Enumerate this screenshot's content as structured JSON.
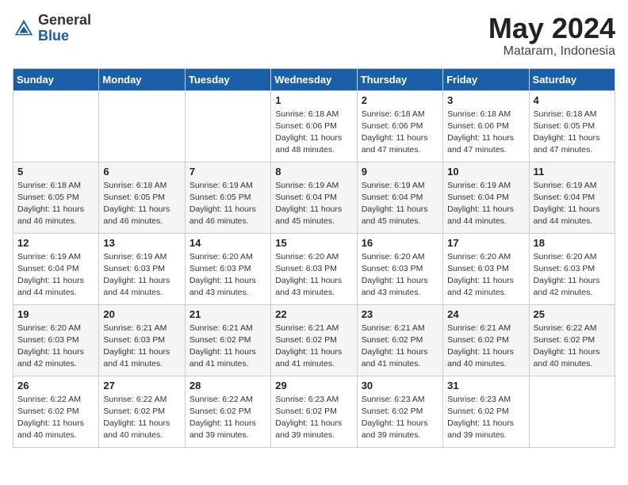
{
  "logo": {
    "general": "General",
    "blue": "Blue"
  },
  "title": {
    "month": "May 2024",
    "location": "Mataram, Indonesia"
  },
  "weekdays": [
    "Sunday",
    "Monday",
    "Tuesday",
    "Wednesday",
    "Thursday",
    "Friday",
    "Saturday"
  ],
  "weeks": [
    [
      {
        "day": "",
        "info": ""
      },
      {
        "day": "",
        "info": ""
      },
      {
        "day": "",
        "info": ""
      },
      {
        "day": "1",
        "info": "Sunrise: 6:18 AM\nSunset: 6:06 PM\nDaylight: 11 hours\nand 48 minutes."
      },
      {
        "day": "2",
        "info": "Sunrise: 6:18 AM\nSunset: 6:06 PM\nDaylight: 11 hours\nand 47 minutes."
      },
      {
        "day": "3",
        "info": "Sunrise: 6:18 AM\nSunset: 6:06 PM\nDaylight: 11 hours\nand 47 minutes."
      },
      {
        "day": "4",
        "info": "Sunrise: 6:18 AM\nSunset: 6:05 PM\nDaylight: 11 hours\nand 47 minutes."
      }
    ],
    [
      {
        "day": "5",
        "info": "Sunrise: 6:18 AM\nSunset: 6:05 PM\nDaylight: 11 hours\nand 46 minutes."
      },
      {
        "day": "6",
        "info": "Sunrise: 6:18 AM\nSunset: 6:05 PM\nDaylight: 11 hours\nand 46 minutes."
      },
      {
        "day": "7",
        "info": "Sunrise: 6:19 AM\nSunset: 6:05 PM\nDaylight: 11 hours\nand 46 minutes."
      },
      {
        "day": "8",
        "info": "Sunrise: 6:19 AM\nSunset: 6:04 PM\nDaylight: 11 hours\nand 45 minutes."
      },
      {
        "day": "9",
        "info": "Sunrise: 6:19 AM\nSunset: 6:04 PM\nDaylight: 11 hours\nand 45 minutes."
      },
      {
        "day": "10",
        "info": "Sunrise: 6:19 AM\nSunset: 6:04 PM\nDaylight: 11 hours\nand 44 minutes."
      },
      {
        "day": "11",
        "info": "Sunrise: 6:19 AM\nSunset: 6:04 PM\nDaylight: 11 hours\nand 44 minutes."
      }
    ],
    [
      {
        "day": "12",
        "info": "Sunrise: 6:19 AM\nSunset: 6:04 PM\nDaylight: 11 hours\nand 44 minutes."
      },
      {
        "day": "13",
        "info": "Sunrise: 6:19 AM\nSunset: 6:03 PM\nDaylight: 11 hours\nand 44 minutes."
      },
      {
        "day": "14",
        "info": "Sunrise: 6:20 AM\nSunset: 6:03 PM\nDaylight: 11 hours\nand 43 minutes."
      },
      {
        "day": "15",
        "info": "Sunrise: 6:20 AM\nSunset: 6:03 PM\nDaylight: 11 hours\nand 43 minutes."
      },
      {
        "day": "16",
        "info": "Sunrise: 6:20 AM\nSunset: 6:03 PM\nDaylight: 11 hours\nand 43 minutes."
      },
      {
        "day": "17",
        "info": "Sunrise: 6:20 AM\nSunset: 6:03 PM\nDaylight: 11 hours\nand 42 minutes."
      },
      {
        "day": "18",
        "info": "Sunrise: 6:20 AM\nSunset: 6:03 PM\nDaylight: 11 hours\nand 42 minutes."
      }
    ],
    [
      {
        "day": "19",
        "info": "Sunrise: 6:20 AM\nSunset: 6:03 PM\nDaylight: 11 hours\nand 42 minutes."
      },
      {
        "day": "20",
        "info": "Sunrise: 6:21 AM\nSunset: 6:03 PM\nDaylight: 11 hours\nand 41 minutes."
      },
      {
        "day": "21",
        "info": "Sunrise: 6:21 AM\nSunset: 6:02 PM\nDaylight: 11 hours\nand 41 minutes."
      },
      {
        "day": "22",
        "info": "Sunrise: 6:21 AM\nSunset: 6:02 PM\nDaylight: 11 hours\nand 41 minutes."
      },
      {
        "day": "23",
        "info": "Sunrise: 6:21 AM\nSunset: 6:02 PM\nDaylight: 11 hours\nand 41 minutes."
      },
      {
        "day": "24",
        "info": "Sunrise: 6:21 AM\nSunset: 6:02 PM\nDaylight: 11 hours\nand 40 minutes."
      },
      {
        "day": "25",
        "info": "Sunrise: 6:22 AM\nSunset: 6:02 PM\nDaylight: 11 hours\nand 40 minutes."
      }
    ],
    [
      {
        "day": "26",
        "info": "Sunrise: 6:22 AM\nSunset: 6:02 PM\nDaylight: 11 hours\nand 40 minutes."
      },
      {
        "day": "27",
        "info": "Sunrise: 6:22 AM\nSunset: 6:02 PM\nDaylight: 11 hours\nand 40 minutes."
      },
      {
        "day": "28",
        "info": "Sunrise: 6:22 AM\nSunset: 6:02 PM\nDaylight: 11 hours\nand 39 minutes."
      },
      {
        "day": "29",
        "info": "Sunrise: 6:23 AM\nSunset: 6:02 PM\nDaylight: 11 hours\nand 39 minutes."
      },
      {
        "day": "30",
        "info": "Sunrise: 6:23 AM\nSunset: 6:02 PM\nDaylight: 11 hours\nand 39 minutes."
      },
      {
        "day": "31",
        "info": "Sunrise: 6:23 AM\nSunset: 6:02 PM\nDaylight: 11 hours\nand 39 minutes."
      },
      {
        "day": "",
        "info": ""
      }
    ]
  ]
}
